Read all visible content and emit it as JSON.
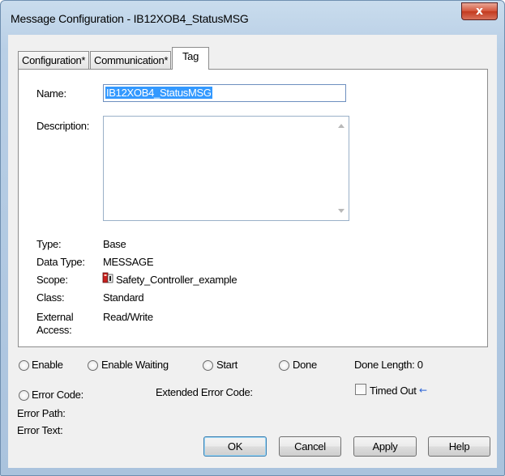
{
  "window": {
    "title": "Message Configuration - IB12XOB4_StatusMSG",
    "close_label": "x"
  },
  "tabs": [
    {
      "label": "Configuration*",
      "active": false
    },
    {
      "label": "Communication*",
      "active": false
    },
    {
      "label": "Tag",
      "active": true
    }
  ],
  "tag": {
    "name_label": "Name:",
    "name_value": "IB12XOB4_StatusMSG",
    "description_label": "Description:",
    "description_value": "",
    "type_label": "Type:",
    "type_value": "Base",
    "data_type_label": "Data Type:",
    "data_type_value": "MESSAGE",
    "scope_label": "Scope:",
    "scope_value": "Safety_Controller_example",
    "class_label": "Class:",
    "class_value": "Standard",
    "external_label_1": "External",
    "external_label_2": "Access:",
    "external_value": "Read/Write"
  },
  "status": {
    "enable": "Enable",
    "enable_waiting": "Enable Waiting",
    "start": "Start",
    "done": "Done",
    "done_length": "Done Length: 0",
    "error_code": "Error Code:",
    "extended_error_code": "Extended Error Code:",
    "timed_out": "Timed Out",
    "error_path": "Error Path:",
    "error_text": "Error Text:"
  },
  "buttons": {
    "ok": "OK",
    "cancel": "Cancel",
    "apply": "Apply",
    "help": "Help"
  },
  "icons": {
    "scope": "controller-icon",
    "timed_out_arrow": "left-arrow-icon"
  },
  "colors": {
    "selection": "#3399ff",
    "close_button": "#c33a1f",
    "accent_arrow": "#2a62d6"
  }
}
